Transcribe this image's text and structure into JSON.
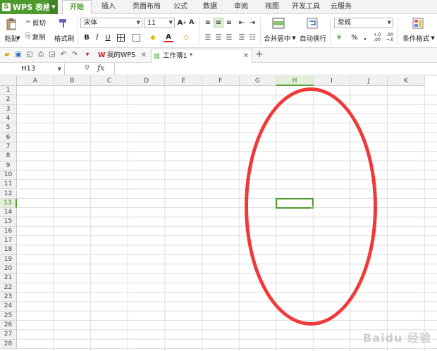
{
  "app": {
    "title": "WPS 表格",
    "logo_letter": "S"
  },
  "menu": {
    "tabs": [
      {
        "label": "开始",
        "active": true
      },
      {
        "label": "插入"
      },
      {
        "label": "页面布局"
      },
      {
        "label": "公式"
      },
      {
        "label": "数据"
      },
      {
        "label": "审阅"
      },
      {
        "label": "视图"
      },
      {
        "label": "开发工具"
      },
      {
        "label": "云服务"
      }
    ]
  },
  "ribbon": {
    "paste": "粘贴",
    "cut": "剪切",
    "copy": "复制",
    "format_painter": "格式刷",
    "font_name": "宋体",
    "font_size": "11",
    "bold": "B",
    "italic": "I",
    "underline": "U",
    "merge_center": "合并居中",
    "auto_wrap": "自动换行",
    "number_format": "常规",
    "percent": "%",
    "comma": "‚",
    "decimals_up": "+.0 .00",
    "decimals_down": ".00 →.0",
    "conditional_format": "条件格式"
  },
  "doc_tabs": [
    {
      "label": "我的WPS"
    },
    {
      "label": "工作簿1 *",
      "active": true
    }
  ],
  "formula_bar": {
    "cell_ref": "H13",
    "fx": "fx"
  },
  "sheet": {
    "columns": [
      "A",
      "B",
      "C",
      "D",
      "E",
      "F",
      "G",
      "H",
      "I",
      "J",
      "K"
    ],
    "rows": [
      "1",
      "2",
      "3",
      "4",
      "5",
      "6",
      "7",
      "8",
      "9",
      "10",
      "11",
      "12",
      "13",
      "14",
      "15",
      "16",
      "17",
      "18",
      "19",
      "20",
      "21",
      "22",
      "23",
      "24",
      "25",
      "26",
      "27",
      "28"
    ],
    "selected_column": "H",
    "selected_row": "13"
  },
  "annotation": {
    "color": "#f03a3a"
  },
  "watermark": "Baidu 经验"
}
